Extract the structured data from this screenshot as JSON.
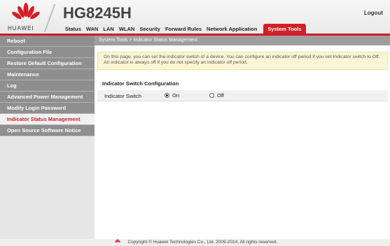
{
  "header": {
    "brand": "HUAWEI",
    "model": "HG8245H",
    "logout": "Logout",
    "tabs": [
      "Status",
      "WAN",
      "LAN",
      "WLAN",
      "Security",
      "Forward Rules",
      "Network Application",
      "System Tools"
    ],
    "active_tab": "System Tools"
  },
  "sidebar": {
    "items": [
      {
        "label": "Reboot"
      },
      {
        "label": "Configuration File"
      },
      {
        "label": "Restore Default Configuration"
      },
      {
        "label": "Maintenance"
      },
      {
        "label": "Log"
      },
      {
        "label": "Advanced Power Management"
      },
      {
        "label": "Modify Login Password"
      },
      {
        "label": "Indicator Status Management"
      },
      {
        "label": "Open Source Software Notice"
      }
    ],
    "active_index": 7
  },
  "breadcrumb": "System Tools > Indicator Status Management",
  "info_text": "On this page, you can set the indicator switch of a device. You can configure an indicator off period if you set Indicator switch to Off. An indicator is always off if you do not specify an indicator off period.",
  "section_title": "Indicator Switch Configuration",
  "indicator_row": {
    "label": "Indicator Switch",
    "options": [
      {
        "label": "On",
        "checked": true
      },
      {
        "label": "Off",
        "checked": false
      }
    ]
  },
  "footer": "Copyright © Huawei Technologies Co., Ltd. 2009-2014. All rights reserved.",
  "colors": {
    "accent": "#d31f26",
    "sidebar": "#8f8f8f",
    "info_bg": "#fbf5d6"
  },
  "icons": {
    "logo": "huawei-logo-icon"
  }
}
